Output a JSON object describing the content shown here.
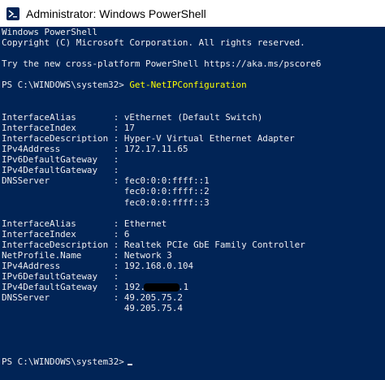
{
  "window": {
    "title": "Administrator: Windows PowerShell"
  },
  "banner": {
    "line1": "Windows PowerShell",
    "line2": "Copyright (C) Microsoft Corporation. All rights reserved.",
    "line3": "Try the new cross-platform PowerShell https://aka.ms/pscore6"
  },
  "prompt": {
    "text": "PS C:\\WINDOWS\\system32>",
    "command": "Get-NetIPConfiguration"
  },
  "adapters": [
    {
      "rows": [
        {
          "key": "InterfaceAlias       ",
          "sep": ":",
          "value": "vEthernet (Default Switch)"
        },
        {
          "key": "InterfaceIndex       ",
          "sep": ":",
          "value": "17"
        },
        {
          "key": "InterfaceDescription ",
          "sep": ":",
          "value": "Hyper-V Virtual Ethernet Adapter"
        },
        {
          "key": "IPv4Address          ",
          "sep": ":",
          "value": "172.17.11.65"
        },
        {
          "key": "IPv6DefaultGateway   ",
          "sep": ":",
          "value": ""
        },
        {
          "key": "IPv4DefaultGateway   ",
          "sep": ":",
          "value": ""
        },
        {
          "key": "DNSServer            ",
          "sep": ":",
          "value": "fec0:0:0:ffff::1"
        },
        {
          "key": "                     ",
          "sep": " ",
          "value": "fec0:0:0:ffff::2"
        },
        {
          "key": "                     ",
          "sep": " ",
          "value": "fec0:0:0:ffff::3"
        }
      ]
    },
    {
      "rows": [
        {
          "key": "InterfaceAlias       ",
          "sep": ":",
          "value": "Ethernet"
        },
        {
          "key": "InterfaceIndex       ",
          "sep": ":",
          "value": "6"
        },
        {
          "key": "InterfaceDescription ",
          "sep": ":",
          "value": "Realtek PCIe GbE Family Controller"
        },
        {
          "key": "NetProfile.Name      ",
          "sep": ":",
          "value": "Network 3"
        },
        {
          "key": "IPv4Address          ",
          "sep": ":",
          "value": "192.168.0.104"
        },
        {
          "key": "IPv6DefaultGateway   ",
          "sep": ":",
          "value": ""
        },
        {
          "key": "IPv4DefaultGateway   ",
          "sep": ":",
          "value": "192."
        },
        {
          "key": "DNSServer            ",
          "sep": ":",
          "value": "49.205.75.2"
        },
        {
          "key": "                     ",
          "sep": " ",
          "value": "49.205.75.4"
        }
      ],
      "gateway_tail": ".1"
    }
  ],
  "final_prompt": {
    "text": "PS C:\\WINDOWS\\system32>"
  }
}
